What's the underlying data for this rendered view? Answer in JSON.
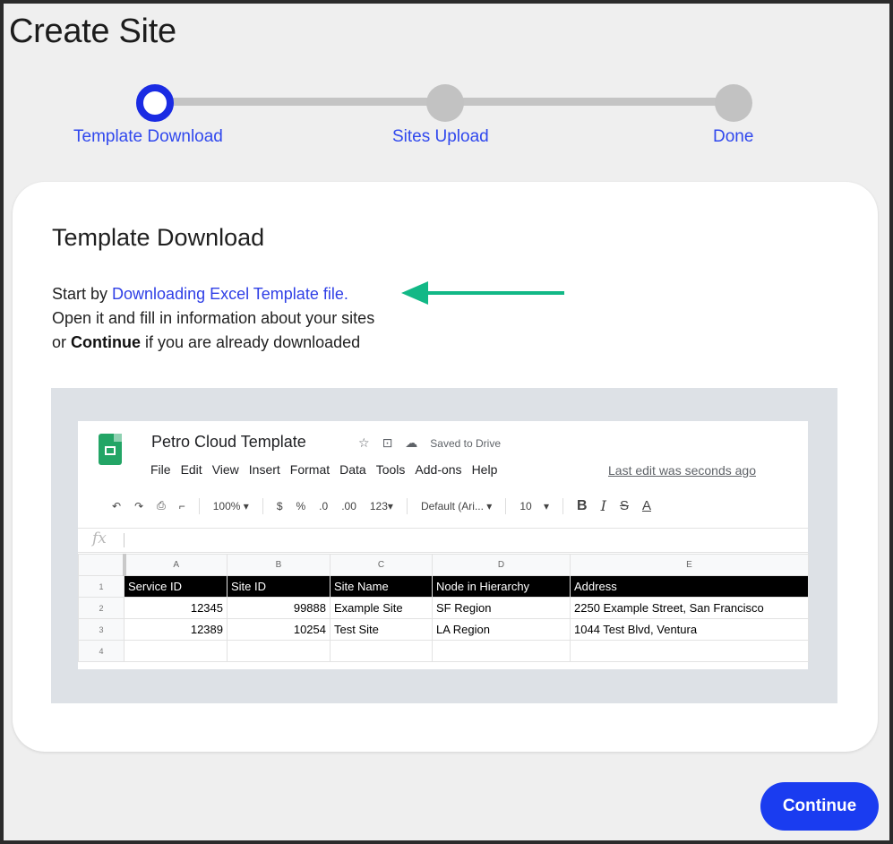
{
  "page": {
    "title": "Create Site"
  },
  "stepper": {
    "steps": [
      {
        "label": "Template Download",
        "state": "active"
      },
      {
        "label": "Sites Upload",
        "state": "inactive"
      },
      {
        "label": "Done",
        "state": "inactive"
      }
    ],
    "active_color": "#1a2be3",
    "inactive_color": "#c2c2c2"
  },
  "card": {
    "title": "Template Download",
    "line1_prefix": "Start by ",
    "download_link": "Downloading Excel Template file.",
    "line2": "Open it and fill in information about your sites",
    "line3_prefix": "or ",
    "line3_bold": "Continue",
    "line3_suffix": " if you are already downloaded",
    "arrow_color": "#12b886"
  },
  "preview": {
    "doc_title": "Petro Cloud Template",
    "saved_status": "Saved to Drive",
    "menu": [
      "File",
      "Edit",
      "View",
      "Insert",
      "Format",
      "Data",
      "Tools",
      "Add-ons",
      "Help"
    ],
    "last_edit": "Last edit was seconds ago",
    "toolbar": {
      "zoom": "100%",
      "currency": "$",
      "percent": "%",
      "dec_less": ".0",
      "dec_more": ".00",
      "format": "123",
      "font": "Default (Ari...",
      "font_size": "10",
      "bold": "B",
      "italic": "I",
      "strike": "S",
      "text_color": "A"
    },
    "fx_label": "fx",
    "columns": [
      "A",
      "B",
      "C",
      "D",
      "E"
    ],
    "header_row": [
      "Service ID",
      "Site ID",
      "Site Name",
      "Node in Hierarchy",
      "Address"
    ],
    "rows": [
      {
        "num": "2",
        "cells": [
          "12345",
          "99888",
          "Example Site",
          "SF Region",
          "2250 Example Street, San Francisco"
        ]
      },
      {
        "num": "3",
        "cells": [
          "12389",
          "10254",
          "Test Site",
          "LA Region",
          "1044 Test Blvd, Ventura"
        ]
      },
      {
        "num": "4",
        "cells": [
          "",
          "",
          "",
          "",
          ""
        ]
      }
    ],
    "header_row_num": "1"
  },
  "actions": {
    "continue_label": "Continue",
    "continue_color": "#1a3cf0"
  }
}
